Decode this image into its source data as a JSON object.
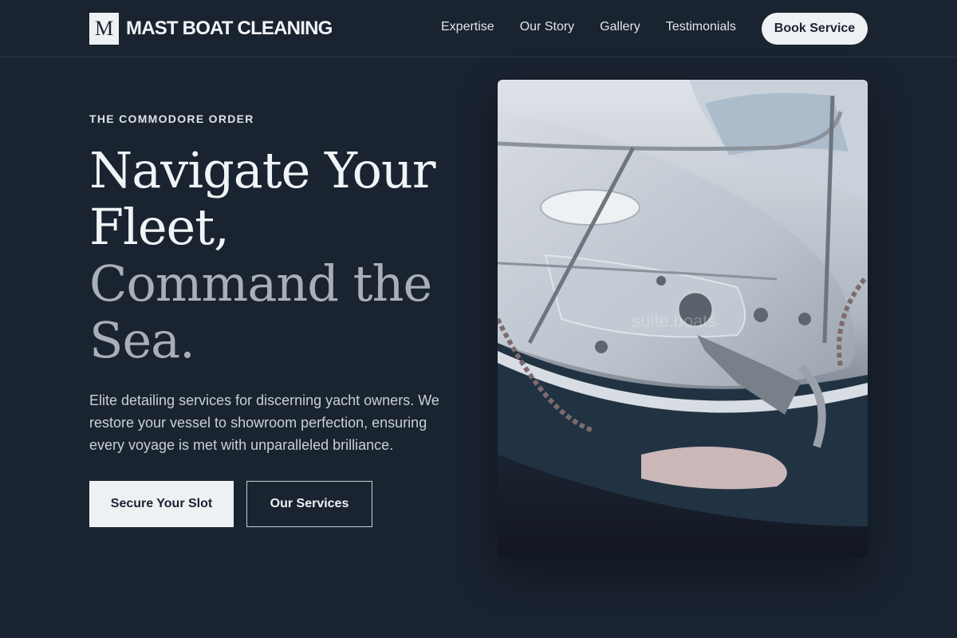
{
  "header": {
    "logo_mark": "M",
    "brand": "MAST BOAT CLEANING",
    "nav": [
      {
        "label": "Expertise"
      },
      {
        "label": "Our Story"
      },
      {
        "label": "Gallery"
      },
      {
        "label": "Testimonials"
      }
    ],
    "cta": "Book Service"
  },
  "hero": {
    "eyebrow": "THE COMMODORE ORDER",
    "headline_line1": "Navigate Your Fleet,",
    "headline_line2": "Command the Sea.",
    "description": "Elite detailing services for discerning yacht owners. We restore your vessel to showroom perfection, ensuring every voyage is met with unparalleled brilliance.",
    "primary_button": "Secure Your Slot",
    "secondary_button": "Our Services",
    "image_watermark": "suite.boats"
  },
  "colors": {
    "background": "#1a2330",
    "accent_light": "#eef1f4",
    "headline_muted": "#a8afb8"
  }
}
